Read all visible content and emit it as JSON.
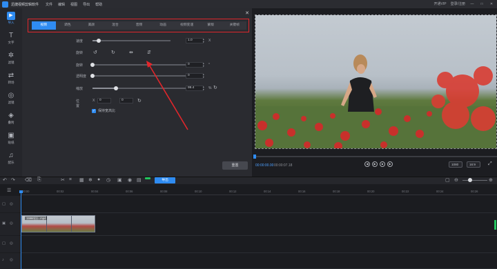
{
  "app": {
    "title": "迅捷视频剪辑软件"
  },
  "menu": [
    "文件",
    "编辑",
    "视图",
    "导出",
    "帮助"
  ],
  "titlebar_right": {
    "vip": "开通VIP",
    "account": "登录/注册",
    "minimize": "—",
    "maximize": "□",
    "close": "✕"
  },
  "sidebar": [
    {
      "label": "导入",
      "icon": "import-icon",
      "active": true
    },
    {
      "label": "文字",
      "icon": "text-icon"
    },
    {
      "label": "滤镜",
      "icon": "filter-icon"
    },
    {
      "label": "转场",
      "icon": "transition-icon"
    },
    {
      "label": "滤镜",
      "icon": "color-icon"
    },
    {
      "label": "叠附",
      "icon": "overlay-icon"
    },
    {
      "label": "贴纸",
      "icon": "sticker-icon"
    },
    {
      "label": "配乐",
      "icon": "music-icon"
    }
  ],
  "panel": {
    "tabs": [
      "视频",
      "调色",
      "美颜",
      "混合",
      "音频",
      "动画",
      "视频变速",
      "蒙版",
      "关键帧"
    ],
    "active_tab": 0,
    "speed": {
      "label": "速度",
      "value": "1.0",
      "unit": "X",
      "level": 0.08
    },
    "rotate": {
      "label": "旋转"
    },
    "rotation": {
      "label": "旋转",
      "value": "0",
      "unit": "°",
      "level": 0.0
    },
    "opacity": {
      "label": "透明度",
      "value": "0",
      "level": 0.0
    },
    "scale": {
      "label": "缩放",
      "value": "99.4",
      "unit": "%",
      "level": 0.25
    },
    "position": {
      "label": "位置",
      "x_label": "X",
      "x": "0",
      "y_label": "Y",
      "y": "0"
    },
    "keep_ratio": {
      "label": "保持宽高比",
      "checked": true
    },
    "reset": "重置"
  },
  "preview": {
    "time_current": "00:00:00.00",
    "time_total": "00:00:07.18",
    "quality": "1080",
    "ratio": "16:9",
    "progress": 0.0
  },
  "toolbar": {
    "export": "导出"
  },
  "timeline": {
    "ticks": [
      "00:00",
      "00:02",
      "00:04",
      "00:06",
      "00:08",
      "00:10",
      "00:12",
      "00:14",
      "00:16",
      "00:18",
      "00:20",
      "00:22",
      "00:24",
      "00:26"
    ],
    "clip": {
      "label": "15960(1)...mp4"
    }
  },
  "colors": {
    "accent": "#2f8cf2",
    "annotation": "#e2262b",
    "panel": "#2a2b30"
  }
}
